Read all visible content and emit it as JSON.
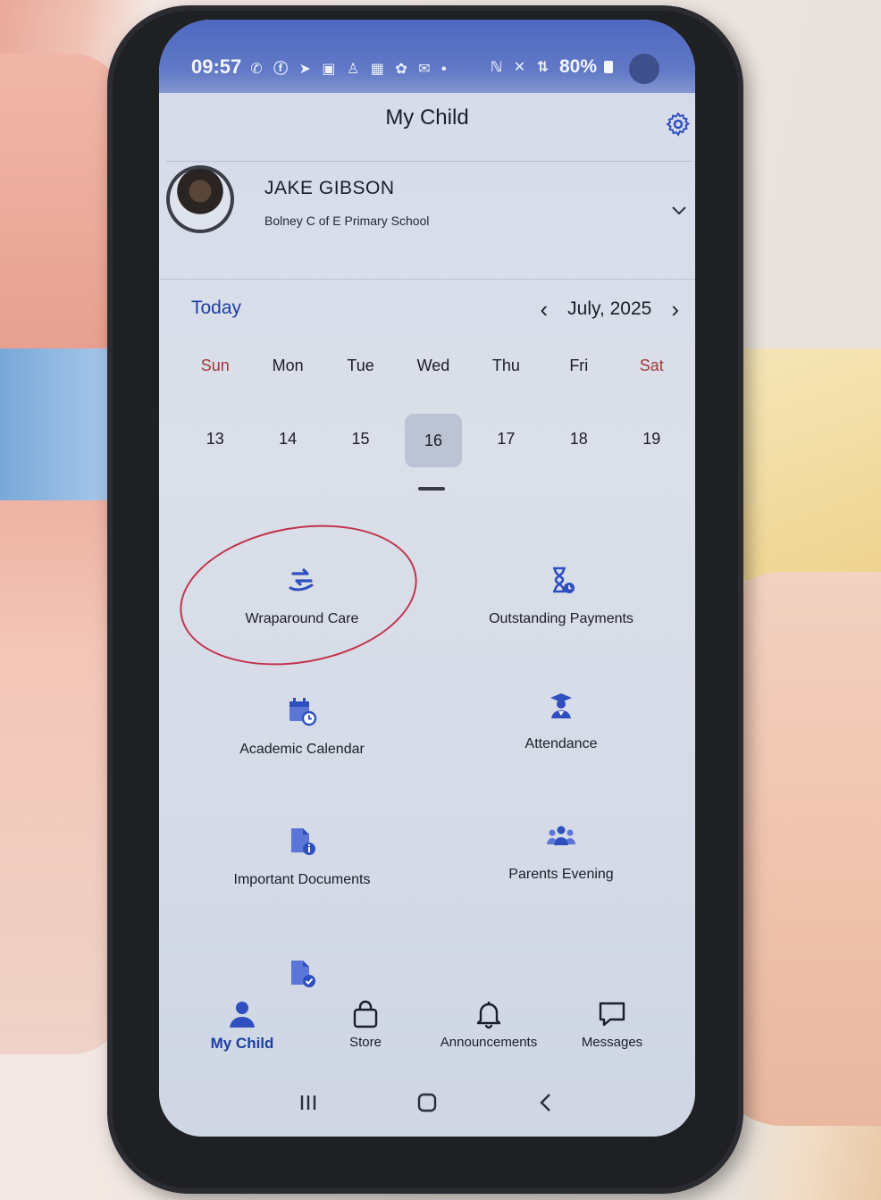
{
  "status_bar": {
    "time": "09:57",
    "left_icons": "✆ ⓕ ➤ ▣ ♙ ▦ ✿ ✉ •",
    "right_icons": "ℕ ✕ ⇅",
    "battery": "80%"
  },
  "header": {
    "title": "My Child"
  },
  "child": {
    "name": "JAKE GIBSON",
    "school": "Bolney C of E Primary School"
  },
  "calendar": {
    "today_label": "Today",
    "month": "July, 2025",
    "days": [
      "Sun",
      "Mon",
      "Tue",
      "Wed",
      "Thu",
      "Fri",
      "Sat"
    ],
    "dates": [
      "13",
      "14",
      "15",
      "16",
      "17",
      "18",
      "19"
    ],
    "selected": "16"
  },
  "tiles": [
    {
      "label": "Wraparound Care",
      "icon": "wraparound-care-icon"
    },
    {
      "label": "Outstanding Payments",
      "icon": "hourglass-icon"
    },
    {
      "label": "Academic Calendar",
      "icon": "calendar-clock-icon"
    },
    {
      "label": "Attendance",
      "icon": "graduate-icon"
    },
    {
      "label": "Important Documents",
      "icon": "document-info-icon"
    },
    {
      "label": "Parents Evening",
      "icon": "people-icon"
    }
  ],
  "tabs": [
    {
      "label": "My Child",
      "active": true
    },
    {
      "label": "Store"
    },
    {
      "label": "Announcements"
    },
    {
      "label": "Messages"
    }
  ],
  "colors": {
    "accent": "#1e3f9f",
    "icon_blue": "#2f4fc0",
    "weekend_red": "#a13a3a",
    "highlight_circle": "#c2324c"
  }
}
